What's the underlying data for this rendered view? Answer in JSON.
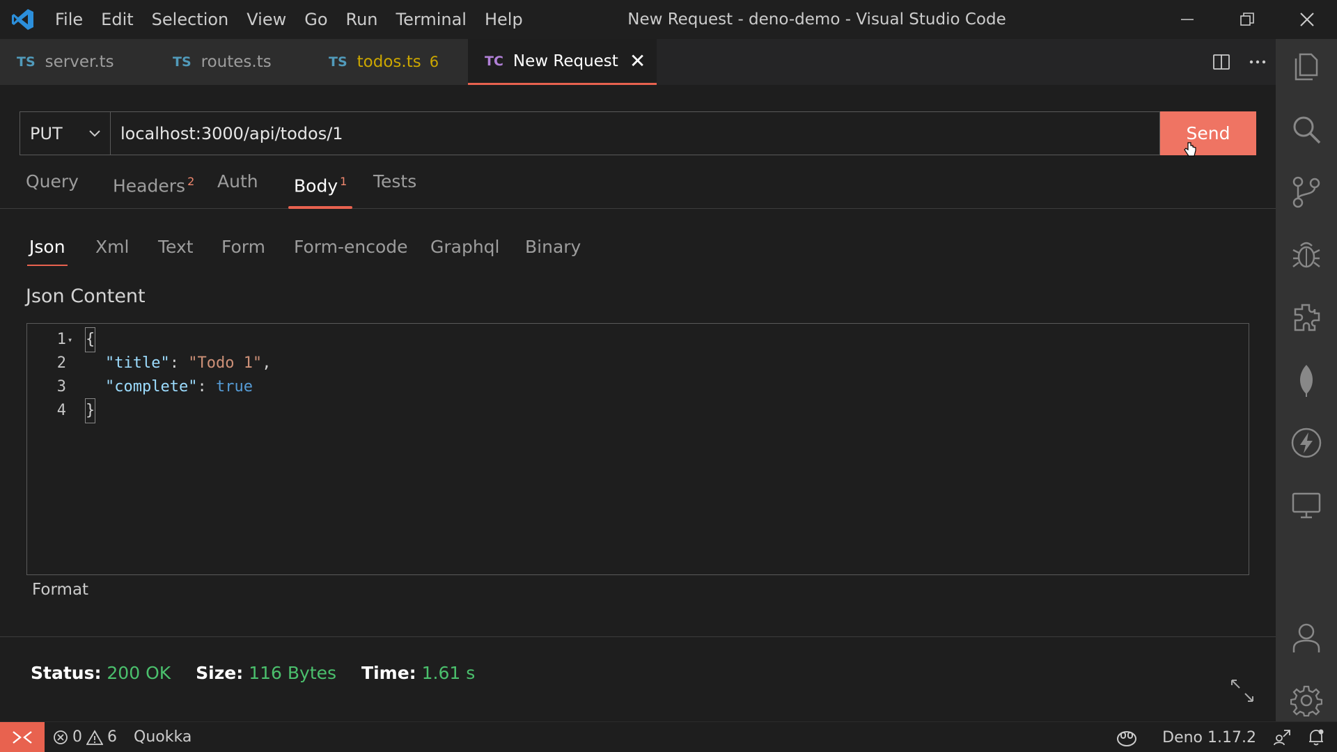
{
  "menu": [
    "File",
    "Edit",
    "Selection",
    "View",
    "Go",
    "Run",
    "Terminal",
    "Help"
  ],
  "window_title": "New Request - deno-demo - Visual Studio Code",
  "tabs": [
    {
      "lang": "TS",
      "name": "server.ts"
    },
    {
      "lang": "TS",
      "name": "routes.ts"
    },
    {
      "lang": "TS",
      "name": "todos.ts",
      "count": "6"
    },
    {
      "lang": "TC",
      "name": "New Request",
      "close": "✕"
    }
  ],
  "request": {
    "method": "PUT",
    "url": "localhost:3000/api/todos/1",
    "send_label": "Send"
  },
  "request_tabs": [
    {
      "label": "Query",
      "badge": ""
    },
    {
      "label": "Headers",
      "badge": "2"
    },
    {
      "label": "Auth",
      "badge": ""
    },
    {
      "label": "Body",
      "badge": "1"
    },
    {
      "label": "Tests",
      "badge": ""
    }
  ],
  "body_tabs": [
    "Json",
    "Xml",
    "Text",
    "Form",
    "Form-encode",
    "Graphql",
    "Binary"
  ],
  "json_label": "Json Content",
  "editor": {
    "line_numbers": [
      "1",
      "2",
      "3",
      "4"
    ],
    "line1": "{",
    "line2_key": "\"title\"",
    "line2_sep": ": ",
    "line2_val": "\"Todo 1\"",
    "line2_end": ",",
    "line3_key": "\"complete\"",
    "line3_sep": ": ",
    "line3_val": "true",
    "line4": "}"
  },
  "format_label": "Format",
  "response": {
    "status_label": "Status:",
    "status_value": "200 OK",
    "size_label": "Size:",
    "size_value": "116 Bytes",
    "time_label": "Time:",
    "time_value": "1.61 s"
  },
  "statusbar": {
    "errors": "0",
    "warnings": "6",
    "quokka": "Quokka",
    "deno": "Deno 1.17.2"
  },
  "colors": {
    "accent": "#e8624f",
    "send": "#ef7463",
    "success": "#4bc06d",
    "warning": "#cca700"
  }
}
